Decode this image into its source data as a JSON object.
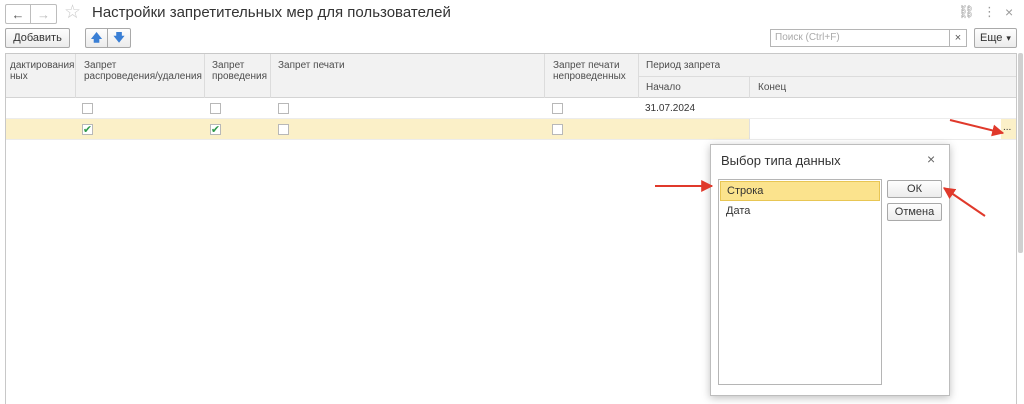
{
  "window": {
    "title": "Настройки запретительных мер для пользователей",
    "back_icon": "←",
    "forward_icon": "→",
    "star_icon": "☆",
    "link_icon": "⛓",
    "more_icon": "⋮",
    "close_icon": "×"
  },
  "toolbar": {
    "add_label": "Добавить",
    "up_icon": "🡅",
    "down_icon": "🡇",
    "search_placeholder": "Поиск (Ctrl+F)",
    "search_clear": "×",
    "more_label": "Еще",
    "more_chevron": "▾"
  },
  "table": {
    "columns": {
      "col1_line1": "дактирования",
      "col1_line2": "ных",
      "col2_line1": "Запрет",
      "col2_line2": "распроведения/удаления",
      "col3_line1": "Запрет",
      "col3_line2": "проведения",
      "col4": "Запрет печати",
      "col5_line1": "Запрет печати",
      "col5_line2": "непроведенных",
      "period": "Период запрета",
      "start": "Начало",
      "end": "Конец"
    },
    "rows": [
      {
        "col2": false,
        "col3": false,
        "col4": false,
        "col5": false,
        "start": "31.07.2024",
        "end": ""
      },
      {
        "col2": true,
        "col3": true,
        "col4": false,
        "col5": false,
        "start": "",
        "end": ""
      }
    ],
    "checkmark": "✔",
    "ellipsis": "..."
  },
  "dialog": {
    "title": "Выбор типа данных",
    "close_icon": "×",
    "items": [
      "Строка",
      "Дата"
    ],
    "selected_index": 0,
    "ok_label": "ОК",
    "cancel_label": "Отмена"
  },
  "colors": {
    "selected_row": "#fbf0c8",
    "selected_item": "#fbe38d",
    "checkmark": "#2f9a4a",
    "annotation_arrow": "#e0392b",
    "arrow_blue": "#3a7fd5"
  }
}
